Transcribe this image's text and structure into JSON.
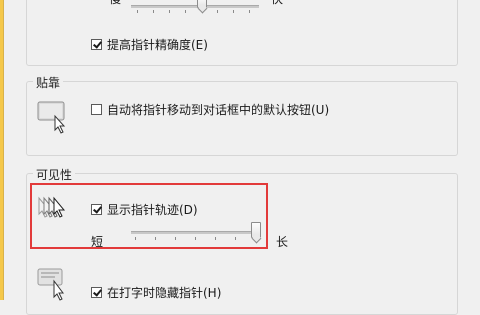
{
  "speed": {
    "slow_label": "慢",
    "fast_label": "快",
    "enhance_precision_label": "提高指针精确度(E)",
    "enhance_precision_checked": true
  },
  "snap_to": {
    "title": "贴靠",
    "auto_move_label": "自动将指针移动到对话框中的默认按钮(U)",
    "auto_move_checked": false
  },
  "visibility": {
    "title": "可见性",
    "show_trails_label": "显示指针轨迹(D)",
    "show_trails_checked": true,
    "short_label": "短",
    "long_label": "长",
    "trail_length_level": 1.0,
    "hide_typing_label": "在打字时隐藏指针(H)",
    "hide_typing_checked": true
  },
  "highlight_color": "#e23a3a"
}
